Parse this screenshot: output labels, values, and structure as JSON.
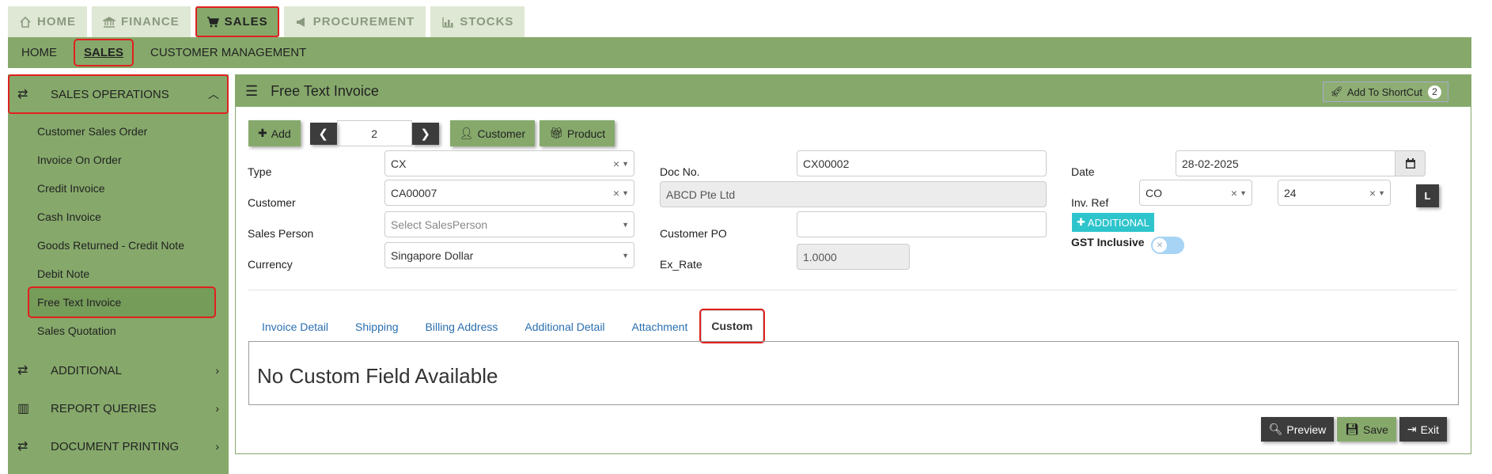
{
  "top_tabs": [
    {
      "label": "HOME",
      "icon": "home-icon"
    },
    {
      "label": "FINANCE",
      "icon": "bank-icon"
    },
    {
      "label": "SALES",
      "icon": "cart-icon",
      "active": true
    },
    {
      "label": "PROCUREMENT",
      "icon": "megaphone-icon"
    },
    {
      "label": "STOCKS",
      "icon": "bar-chart-icon"
    }
  ],
  "subnav": [
    {
      "label": "HOME"
    },
    {
      "label": "SALES",
      "active": true
    },
    {
      "label": "CUSTOMER MANAGEMENT"
    }
  ],
  "sidebar": {
    "sales_operations": "SALES OPERATIONS",
    "items": [
      "Customer Sales Order",
      "Invoice On Order",
      "Credit Invoice",
      "Cash Invoice",
      "Goods Returned - Credit Note",
      "Debit Note",
      "Free Text Invoice",
      "Sales Quotation"
    ],
    "active_item": "Free Text Invoice",
    "additional": "ADDITIONAL",
    "report_queries": "REPORT QUERIES",
    "document_printing": "DOCUMENT PRINTING"
  },
  "header": {
    "title": "Free Text Invoice",
    "shortcut_label": "Add To ShortCut",
    "shortcut_count": "2"
  },
  "toolbar": {
    "add_label": "Add",
    "record_number": "2",
    "customer_label": "Customer",
    "product_label": "Product"
  },
  "form": {
    "type_label": "Type",
    "type_value": "CX",
    "customer_label": "Customer",
    "customer_value": "CA00007",
    "sales_person_label": "Sales Person",
    "sales_person_placeholder": "Select SalesPerson",
    "currency_label": "Currency",
    "currency_value": "Singapore Dollar",
    "doc_no_label": "Doc No.",
    "doc_no_value": "CX00002",
    "customer_name_value": "ABCD Pte Ltd",
    "customer_po_label": "Customer PO",
    "customer_po_value": "",
    "ex_rate_label": "Ex_Rate",
    "ex_rate_value": "1.0000",
    "date_label": "Date",
    "date_value": "28-02-2025",
    "inv_ref_label": "Inv. Ref",
    "inv_ref_prefix": "CO",
    "inv_ref_number": "24",
    "l_button": "L",
    "additional_label": "ADDITIONAL",
    "gst_label": "GST Inclusive",
    "gst_inclusive": false
  },
  "tabs": [
    {
      "label": "Invoice Detail"
    },
    {
      "label": "Shipping"
    },
    {
      "label": "Billing Address"
    },
    {
      "label": "Additional Detail"
    },
    {
      "label": "Attachment"
    },
    {
      "label": "Custom",
      "active": true
    }
  ],
  "tab_content_message": "No Custom Field Available",
  "footer": {
    "preview_label": "Preview",
    "save_label": "Save",
    "exit_label": "Exit"
  },
  "colors": {
    "accent_green": "#86a96b",
    "light_green": "#dfe8d4",
    "dark_button": "#3c3c3c",
    "cyan_button": "#2ec4cc",
    "highlight_red": "#e02020"
  }
}
